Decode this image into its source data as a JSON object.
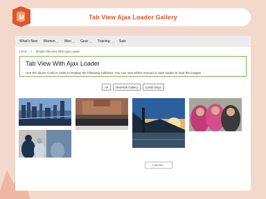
{
  "header": {
    "title": "Tab View Ajax Loader Gallery"
  },
  "nav": {
    "items": [
      {
        "label": "What's New",
        "has_chevron": false
      },
      {
        "label": "Women",
        "has_chevron": true
      },
      {
        "label": "Men",
        "has_chevron": true
      },
      {
        "label": "Gear",
        "has_chevron": true
      },
      {
        "label": "Training",
        "has_chevron": true
      },
      {
        "label": "Sale",
        "has_chevron": false
      }
    ]
  },
  "breadcrumb": {
    "home": "Home",
    "separator": ">",
    "current": "Simple Tab View With Ajax Loader"
  },
  "intro": {
    "title": "Tab View With Ajax Loader",
    "description": "Use the above Code in order to Display the following Galleries. You can user either manual or auto loader to load the images"
  },
  "tabs": [
    {
      "label": "All"
    },
    {
      "label": "NewYork Gallery"
    },
    {
      "label": "LUMS Days"
    }
  ],
  "load_more": {
    "label": "Load Mo..."
  },
  "colors": {
    "accent": "#e0552d",
    "highlight_border": "#7ab648",
    "background": "#f3d9cc"
  }
}
